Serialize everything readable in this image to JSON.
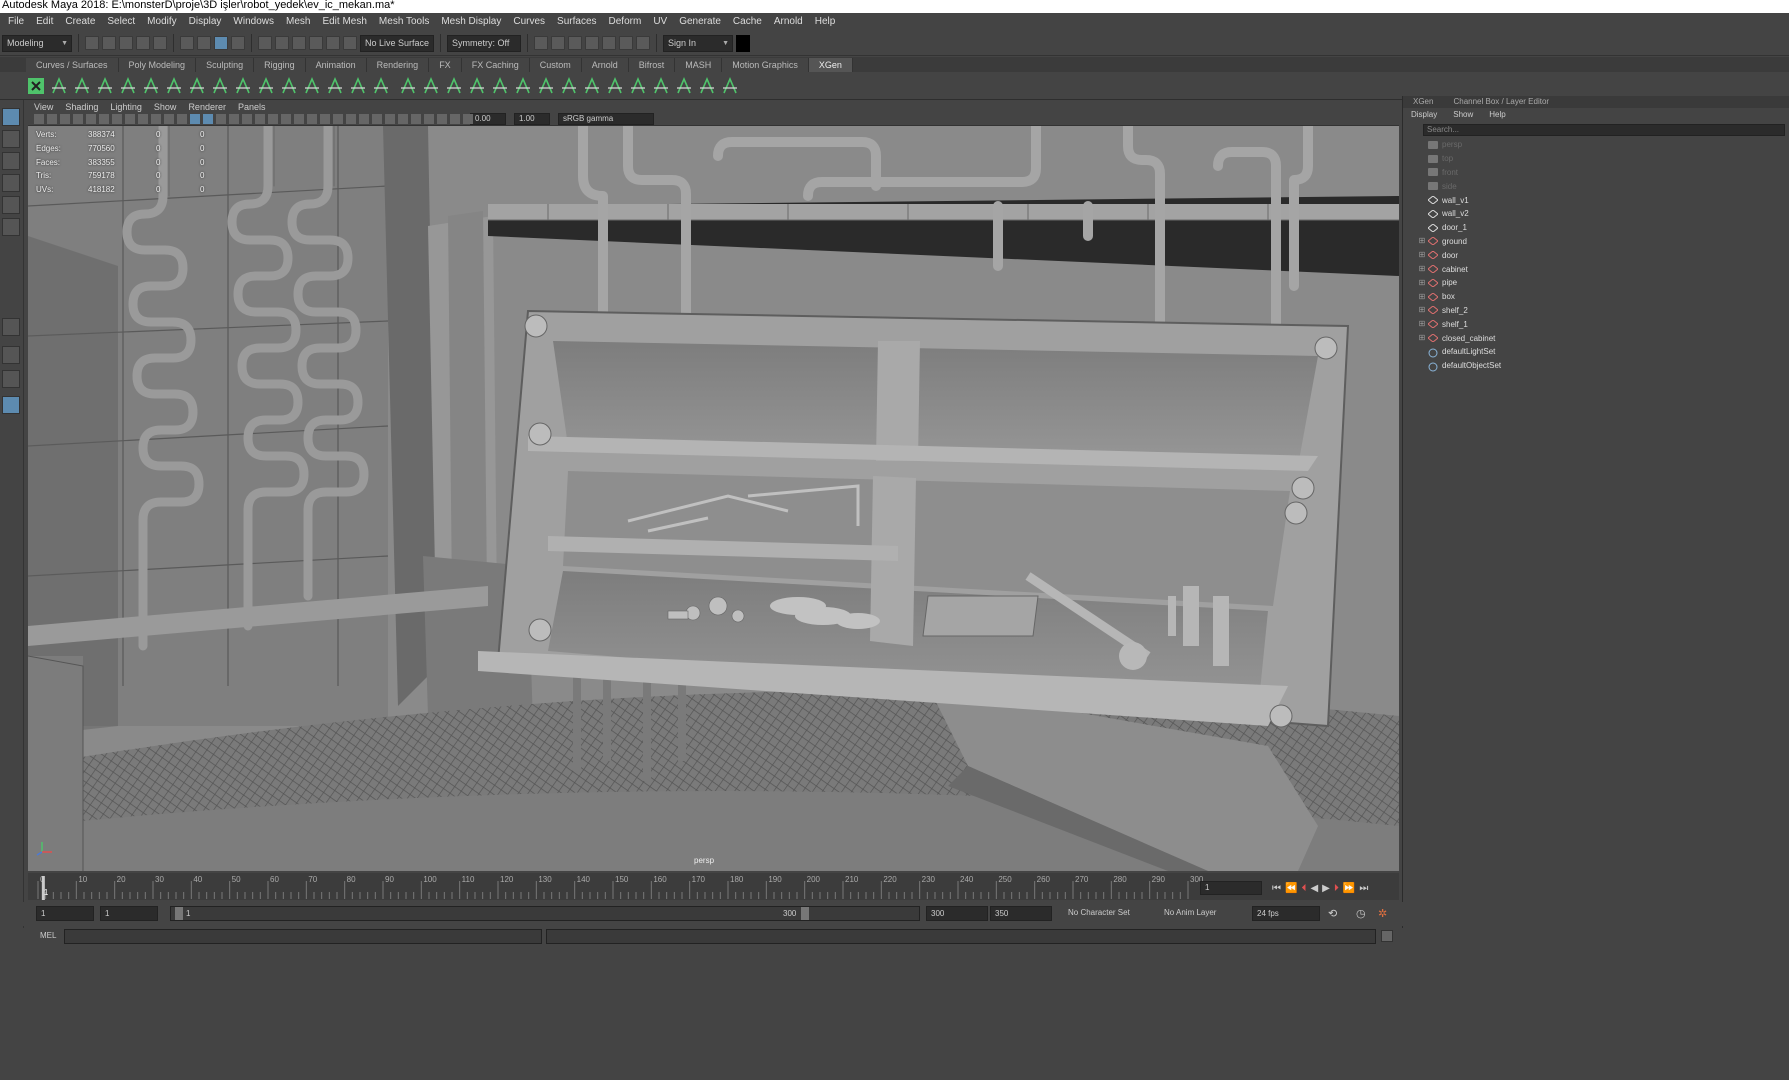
{
  "window": {
    "title": "Autodesk Maya 2018: E:\\monsterD\\proje\\3D işler\\robot_yedek\\ev_ic_mekan.ma*"
  },
  "menubar": [
    "File",
    "Edit",
    "Create",
    "Select",
    "Modify",
    "Display",
    "Windows",
    "Mesh",
    "Edit Mesh",
    "Mesh Tools",
    "Mesh Display",
    "Curves",
    "Surfaces",
    "Deform",
    "UV",
    "Generate",
    "Cache",
    "Arnold",
    "Help"
  ],
  "statusline": {
    "menuset": "Modeling",
    "live_surface": "No Live Surface",
    "symmetry": "Symmetry: Off",
    "signin": "Sign In"
  },
  "shelf_tabs": [
    "Curves / Surfaces",
    "Poly Modeling",
    "Sculpting",
    "Rigging",
    "Animation",
    "Rendering",
    "FX",
    "FX Caching",
    "Custom",
    "Arnold",
    "Bifrost",
    "MASH",
    "Motion Graphics",
    "XGen"
  ],
  "active_shelf_tab": "XGen",
  "panel_menu": [
    "View",
    "Shading",
    "Lighting",
    "Show",
    "Renderer",
    "Panels"
  ],
  "panel_toolbar": {
    "exposure": "0.00",
    "gamma": "1.00",
    "colorspace": "sRGB gamma"
  },
  "hud": [
    {
      "label": "Verts:",
      "v1": "388374",
      "v2": "0",
      "v3": "0"
    },
    {
      "label": "Edges:",
      "v1": "770560",
      "v2": "0",
      "v3": "0"
    },
    {
      "label": "Faces:",
      "v1": "383355",
      "v2": "0",
      "v3": "0"
    },
    {
      "label": "Tris:",
      "v1": "759178",
      "v2": "0",
      "v3": "0"
    },
    {
      "label": "UVs:",
      "v1": "418182",
      "v2": "0",
      "v3": "0"
    }
  ],
  "camera_label": "persp",
  "right_tabs": [
    "XGen",
    "Channel Box / Layer Editor"
  ],
  "outliner_menu": [
    "Display",
    "Show",
    "Help"
  ],
  "outliner_search_placeholder": "Search...",
  "outliner": [
    {
      "label": "persp",
      "type": "camera",
      "dim": true
    },
    {
      "label": "top",
      "type": "camera",
      "dim": true
    },
    {
      "label": "front",
      "type": "camera",
      "dim": true
    },
    {
      "label": "side",
      "type": "camera",
      "dim": true
    },
    {
      "label": "wall_v1",
      "type": "mesh",
      "dim": false
    },
    {
      "label": "wall_v2",
      "type": "mesh",
      "dim": false
    },
    {
      "label": "door_1",
      "type": "mesh",
      "dim": false
    },
    {
      "label": "ground",
      "type": "group",
      "dim": false
    },
    {
      "label": "door",
      "type": "group",
      "dim": false
    },
    {
      "label": "cabinet",
      "type": "group",
      "dim": false
    },
    {
      "label": "pipe",
      "type": "group",
      "dim": false
    },
    {
      "label": "box",
      "type": "group",
      "dim": false
    },
    {
      "label": "shelf_2",
      "type": "group",
      "dim": false
    },
    {
      "label": "shelf_1",
      "type": "group",
      "dim": false
    },
    {
      "label": "closed_cabinet",
      "type": "group",
      "dim": false
    },
    {
      "label": "defaultLightSet",
      "type": "set",
      "dim": false
    },
    {
      "label": "defaultObjectSet",
      "type": "set",
      "dim": false
    }
  ],
  "timeline": {
    "ticks": [
      "0",
      "10",
      "20",
      "30",
      "40",
      "50",
      "60",
      "70",
      "80",
      "90",
      "100",
      "110",
      "120",
      "130",
      "140",
      "150",
      "160",
      "170",
      "180",
      "190",
      "200",
      "210",
      "220",
      "230",
      "240",
      "250",
      "260",
      "270",
      "280",
      "290",
      "300"
    ],
    "current_frame": "1",
    "current_frame_field": "1"
  },
  "range": {
    "start": "1",
    "start2": "1",
    "slider_start": "1",
    "slider_end": "300",
    "end": "300",
    "end2": "350",
    "character_set": "No Character Set",
    "anim_layer": "No Anim Layer",
    "fps": "24 fps"
  },
  "cmdline": {
    "label": "MEL"
  },
  "colors": {
    "accent": "#5d8bb0",
    "shelf_green": "#4fc36b",
    "outliner_red": "#e07070"
  }
}
